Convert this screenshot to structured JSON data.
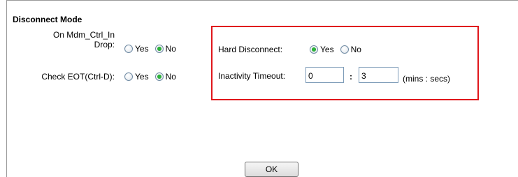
{
  "section": {
    "title": "Disconnect Mode"
  },
  "on_mdm_ctrl_in_drop": {
    "label_line1": "On Mdm_Ctrl_In",
    "label_line2": "Drop:",
    "options": [
      "Yes",
      "No"
    ],
    "selected": "No"
  },
  "check_eot": {
    "label": "Check EOT(Ctrl-D):",
    "options": [
      "Yes",
      "No"
    ],
    "selected": "No"
  },
  "hard_disconnect": {
    "label": "Hard Disconnect:",
    "options": [
      "Yes",
      "No"
    ],
    "selected": "Yes"
  },
  "inactivity_timeout": {
    "label": "Inactivity Timeout:",
    "minutes": "0",
    "separator": ":",
    "seconds": "3",
    "units": "(mins : secs)"
  },
  "ok_button": {
    "label": "OK"
  },
  "colors": {
    "highlight_border": "#e0161b",
    "radio_selected": "#2bb53a"
  }
}
